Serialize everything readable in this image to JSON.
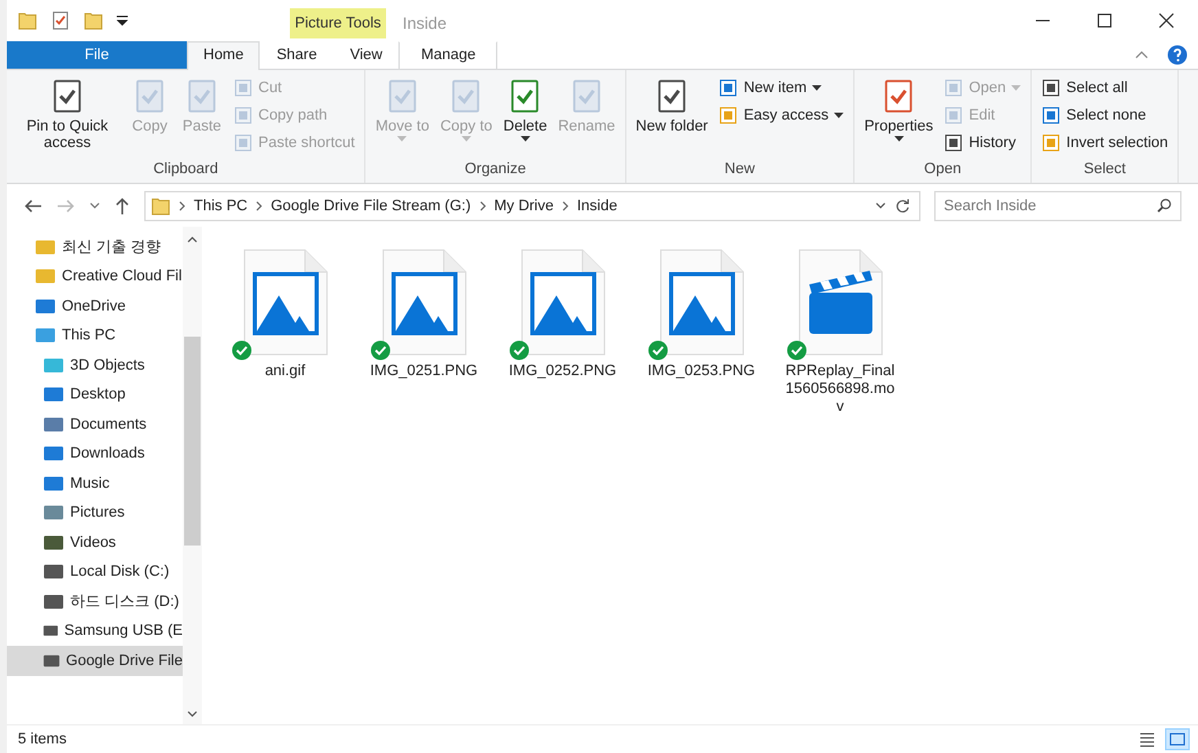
{
  "window": {
    "title": "Inside",
    "context_tab": "Picture Tools"
  },
  "tabs": [
    {
      "label": "File",
      "kind": "file",
      "selected": false
    },
    {
      "label": "Home",
      "kind": "normal",
      "selected": true
    },
    {
      "label": "Share",
      "kind": "normal",
      "selected": false
    },
    {
      "label": "View",
      "kind": "normal",
      "selected": false
    },
    {
      "label": "Manage",
      "kind": "contextual",
      "selected": false
    }
  ],
  "ribbon": [
    {
      "label": "Clipboard",
      "items": [
        {
          "label": "Pin to Quick access",
          "kind": "large",
          "disabled": false,
          "dropdown": false
        },
        {
          "label": "Copy",
          "kind": "large",
          "disabled": true,
          "dropdown": false
        },
        {
          "label": "Paste",
          "kind": "large",
          "disabled": true,
          "dropdown": false
        },
        {
          "label": "Cut",
          "kind": "small",
          "disabled": true,
          "dropdown": false
        },
        {
          "label": "Copy path",
          "kind": "small",
          "disabled": true,
          "dropdown": false
        },
        {
          "label": "Paste shortcut",
          "kind": "small",
          "disabled": true,
          "dropdown": false
        }
      ]
    },
    {
      "label": "Organize",
      "items": [
        {
          "label": "Move to",
          "kind": "large",
          "disabled": true,
          "dropdown": true
        },
        {
          "label": "Copy to",
          "kind": "large",
          "disabled": true,
          "dropdown": true
        },
        {
          "label": "Delete",
          "kind": "large",
          "disabled": false,
          "dropdown": true
        },
        {
          "label": "Rename",
          "kind": "large",
          "disabled": true,
          "dropdown": false
        }
      ]
    },
    {
      "label": "New",
      "items": [
        {
          "label": "New folder",
          "kind": "large",
          "disabled": false,
          "dropdown": false
        },
        {
          "label": "New item",
          "kind": "small",
          "disabled": false,
          "dropdown": true
        },
        {
          "label": "Easy access",
          "kind": "small",
          "disabled": false,
          "dropdown": true
        }
      ]
    },
    {
      "label": "Open",
      "items": [
        {
          "label": "Properties",
          "kind": "large",
          "disabled": false,
          "dropdown": true
        },
        {
          "label": "Open",
          "kind": "small",
          "disabled": true,
          "dropdown": true
        },
        {
          "label": "Edit",
          "kind": "small",
          "disabled": true,
          "dropdown": false
        },
        {
          "label": "History",
          "kind": "small",
          "disabled": false,
          "dropdown": false
        }
      ]
    },
    {
      "label": "Select",
      "items": [
        {
          "label": "Select all",
          "kind": "small",
          "disabled": false,
          "dropdown": false
        },
        {
          "label": "Select none",
          "kind": "small",
          "disabled": false,
          "dropdown": false
        },
        {
          "label": "Invert selection",
          "kind": "small",
          "disabled": false,
          "dropdown": false
        }
      ]
    }
  ],
  "address": {
    "path": [
      "This PC",
      "Google Drive File Stream (G:)",
      "My Drive",
      "Inside"
    ],
    "search_placeholder": "Search Inside"
  },
  "sidebar": {
    "items": [
      {
        "label": "최신 기출 경향",
        "selected": false
      },
      {
        "label": "Creative Cloud Fil",
        "selected": false
      },
      {
        "label": "OneDrive",
        "selected": false
      },
      {
        "label": "This PC",
        "selected": false,
        "children": [
          {
            "label": "3D Objects",
            "selected": false
          },
          {
            "label": "Desktop",
            "selected": false
          },
          {
            "label": "Documents",
            "selected": false
          },
          {
            "label": "Downloads",
            "selected": false
          },
          {
            "label": "Music",
            "selected": false
          },
          {
            "label": "Pictures",
            "selected": false
          },
          {
            "label": "Videos",
            "selected": false
          },
          {
            "label": "Local Disk (C:)",
            "selected": false
          },
          {
            "label": "하드 디스크 (D:)",
            "selected": false
          },
          {
            "label": "Samsung USB (E",
            "selected": false
          },
          {
            "label": "Google Drive File",
            "selected": true
          }
        ]
      }
    ]
  },
  "files": [
    {
      "name": "ani.gif",
      "kind": "image",
      "synced": true
    },
    {
      "name": "IMG_0251.PNG",
      "kind": "image",
      "synced": true
    },
    {
      "name": "IMG_0252.PNG",
      "kind": "image",
      "synced": true
    },
    {
      "name": "IMG_0253.PNG",
      "kind": "image",
      "synced": true
    },
    {
      "name": "RPReplay_Final1560566898.mov",
      "kind": "video",
      "synced": true
    }
  ],
  "status_bar": {
    "count": "5 items",
    "views": [
      {
        "selected": false
      },
      {
        "selected": true
      }
    ]
  }
}
